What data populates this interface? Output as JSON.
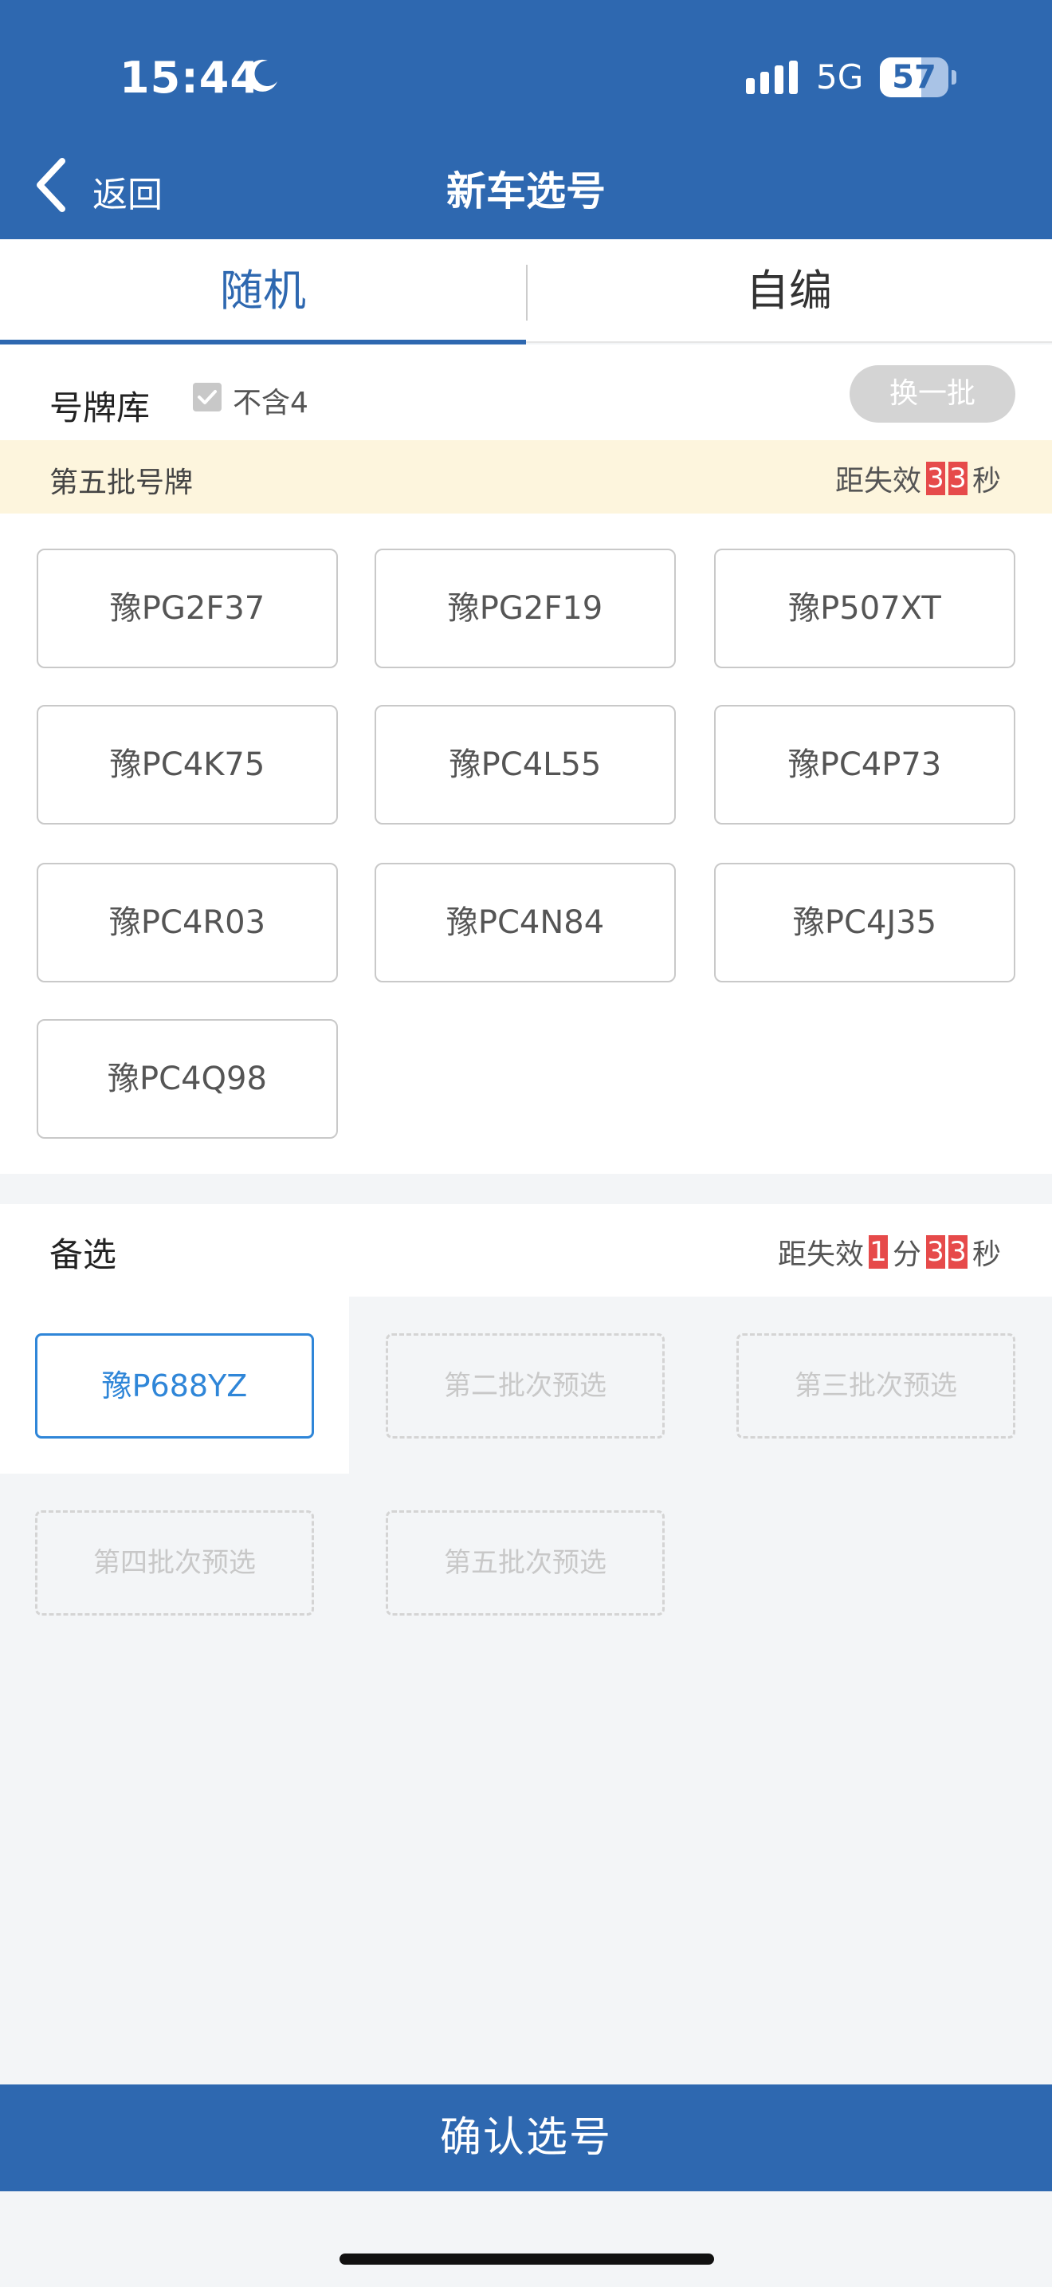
{
  "status_bar": {
    "time": "15:44",
    "network": "5G",
    "battery": "57",
    "icons": [
      "moon-icon",
      "signal-icon"
    ]
  },
  "nav": {
    "back_label": "返回",
    "title": "新车选号"
  },
  "tabs": [
    {
      "label": "随机",
      "active": true
    },
    {
      "label": "自编",
      "active": false
    }
  ],
  "library": {
    "title": "号牌库",
    "exclude_four_label": "不含4",
    "exclude_four_checked": true,
    "swap_button": "换一批",
    "batch_title": "第五批号牌",
    "countdown_prefix": "距失效",
    "countdown_digits": [
      "3",
      "3"
    ],
    "countdown_suffix": "秒",
    "plates": [
      "豫PG2F37",
      "豫PG2F19",
      "豫P507XT",
      "豫PC4K75",
      "豫PC4L55",
      "豫PC4P73",
      "豫PC4R03",
      "豫PC4N84",
      "豫PC4J35",
      "豫PC4Q98"
    ]
  },
  "alternatives": {
    "title": "备选",
    "countdown_prefix": "距失效",
    "minutes": "1",
    "minutes_unit": "分",
    "seconds_digits": [
      "3",
      "3"
    ],
    "seconds_unit": "秒",
    "slots": [
      "豫P688YZ",
      "第二批次预选",
      "第三批次预选",
      "第四批次预选",
      "第五批次预选"
    ]
  },
  "confirm_button": "确认选号",
  "colors": {
    "primary": "#2e68b0",
    "countdown_red": "#e64a4a",
    "batch_bar_bg": "#fdf5dd",
    "selected_blue": "#2f86d8"
  }
}
